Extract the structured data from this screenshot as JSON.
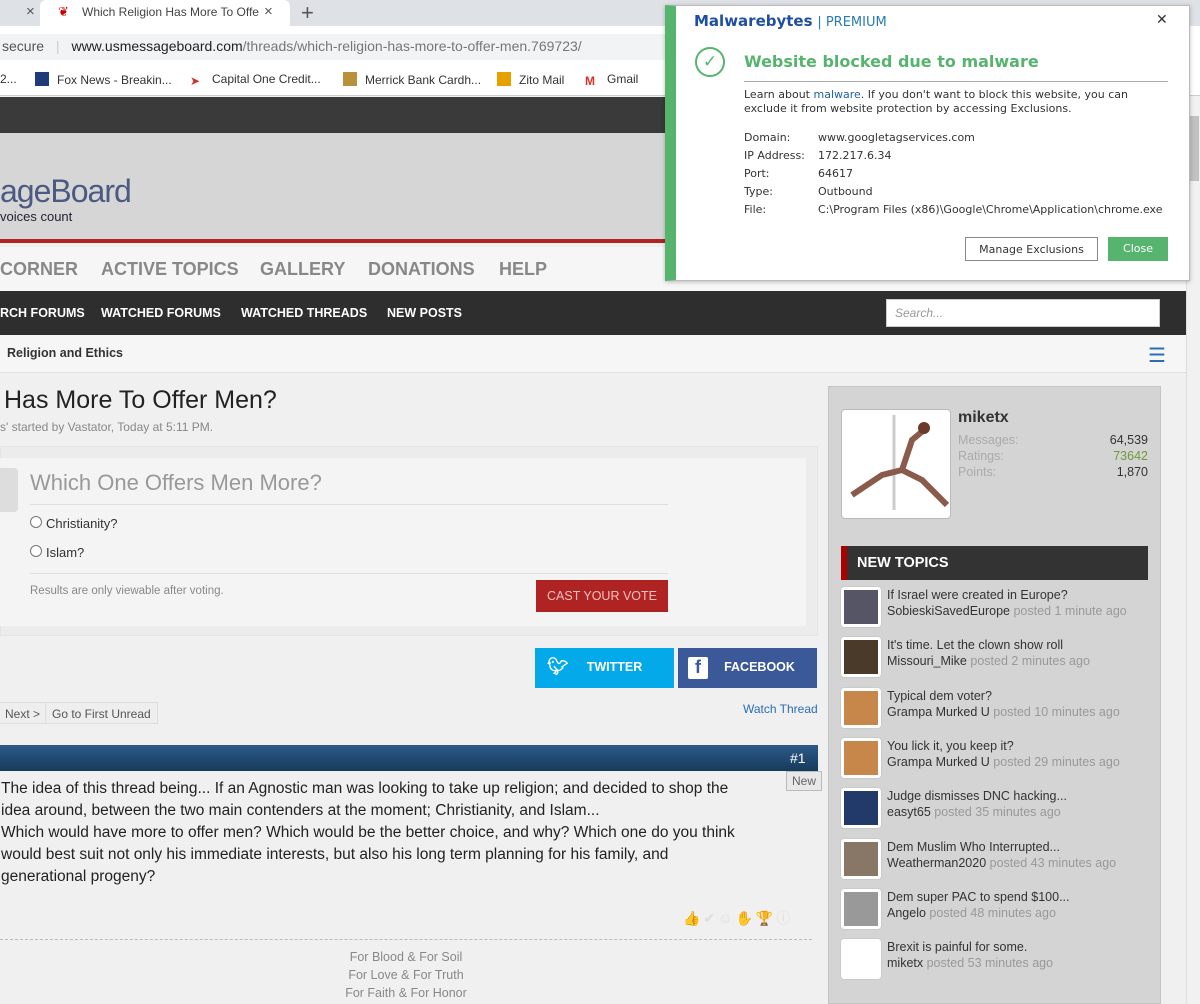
{
  "browser": {
    "prev_tab_close": "×",
    "active_tab_title": "Which Religion Has More To Offe",
    "tab_close": "×",
    "new_tab": "+",
    "security_label": "secure",
    "url_domain": "www.usmessageboard.com",
    "url_path": "/threads/which-religion-has-more-to-offer-men.769723/",
    "bookmarks": [
      {
        "label": "2...",
        "color": "#888"
      },
      {
        "label": "Fox News - Breakin...",
        "color": "#1f3b7a"
      },
      {
        "label": "Capital One Credit...",
        "color": "#d22e2e"
      },
      {
        "label": "Merrick Bank Cardh...",
        "color": "#b8913a"
      },
      {
        "label": "Zito Mail",
        "color": "#e6a000"
      },
      {
        "label": "Gmail",
        "color": "#d93025"
      }
    ]
  },
  "site": {
    "logo": "ageBoard",
    "tagline": "voices count",
    "nav_main": [
      "CORNER",
      "ACTIVE TOPICS",
      "GALLERY",
      "DONATIONS",
      "HELP"
    ],
    "nav_sub": [
      "RCH FORUMS",
      "WATCHED FORUMS",
      "WATCHED THREADS",
      "NEW POSTS"
    ],
    "search_placeholder": "Search...",
    "breadcrumb": "Religion and Ethics"
  },
  "thread": {
    "title": "Has More To Offer Men?",
    "meta": "s' started by Vastator, Today at 5:11 PM.",
    "poll": {
      "question": "Which One Offers Men More?",
      "options": [
        "Christianity?",
        "Islam?"
      ],
      "note": "Results are only viewable after voting.",
      "vote_button": "CAST YOUR VOTE"
    },
    "share": {
      "twitter": "TWITTER",
      "facebook": "FACEBOOK"
    },
    "pager": {
      "next": "Next >",
      "first_unread": "Go to First Unread"
    },
    "watch": "Watch Thread",
    "post": {
      "number": "#1",
      "badge": "New",
      "body_lines": [
        "The idea of this thread being... If an Agnostic man was looking to take up religion; and decided to shop the",
        "idea around, between the two main contenders at the moment; Christianity, and Islam...",
        "Which would have more to offer men? Which would be the better choice, and why? Which one do you think",
        "would best suit not only his immediate interests, but also his long term planning for his family, and",
        "generational progeny?"
      ],
      "signature": [
        "For Blood & For Soil",
        "For Love & For Truth",
        "For Faith & For Honor"
      ]
    }
  },
  "sidebar": {
    "user": {
      "name": "miketx",
      "stats": [
        {
          "label": "Messages:",
          "value": "64,539"
        },
        {
          "label": "Ratings:",
          "value": "73642"
        },
        {
          "label": "Points:",
          "value": "1,870"
        }
      ]
    },
    "new_topics_title": "NEW TOPICS",
    "topics": [
      {
        "title": "If Israel were created in Europe?",
        "user": "SobieskiSavedEurope",
        "time": "posted 1 minute ago"
      },
      {
        "title": "It's time. Let the clown show roll",
        "user": "Missouri_Mike",
        "time": "posted 2 minutes ago"
      },
      {
        "title": "Typical dem voter?",
        "user": "Grampa Murked U",
        "time": "posted 10 minutes ago"
      },
      {
        "title": "You lick it, you keep it?",
        "user": "Grampa Murked U",
        "time": "posted 29 minutes ago"
      },
      {
        "title": "Judge dismisses DNC hacking...",
        "user": "easyt65",
        "time": "posted 35 minutes ago"
      },
      {
        "title": "Dem Muslim Who Interrupted...",
        "user": "Weatherman2020",
        "time": "posted 43 minutes ago"
      },
      {
        "title": "Dem super PAC to spend $100...",
        "user": "Angelo",
        "time": "posted 48 minutes ago"
      },
      {
        "title": "Brexit is painful for some.",
        "user": "miketx",
        "time": "posted 53 minutes ago"
      }
    ]
  },
  "popup": {
    "brand": "Malwarebytes",
    "edition": "| PREMIUM",
    "close": "✕",
    "heading": "Website blocked due to malware",
    "desc_pre": "Learn about ",
    "desc_link": "malware",
    "desc_post": ". If you don't want to block this website, you can",
    "desc_line2": "exclude it from website protection by accessing Exclusions.",
    "details": [
      {
        "label": "Domain:",
        "value": "www.googletagservices.com"
      },
      {
        "label": "IP Address:",
        "value": "172.217.6.34"
      },
      {
        "label": "Port:",
        "value": "64617"
      },
      {
        "label": "Type:",
        "value": "Outbound"
      },
      {
        "label": "File:",
        "value": "C:\\Program Files (x86)\\Google\\Chrome\\Application\\chrome.exe"
      }
    ],
    "manage_button": "Manage Exclusions",
    "close_button": "Close",
    "accent": "#56b46e"
  }
}
